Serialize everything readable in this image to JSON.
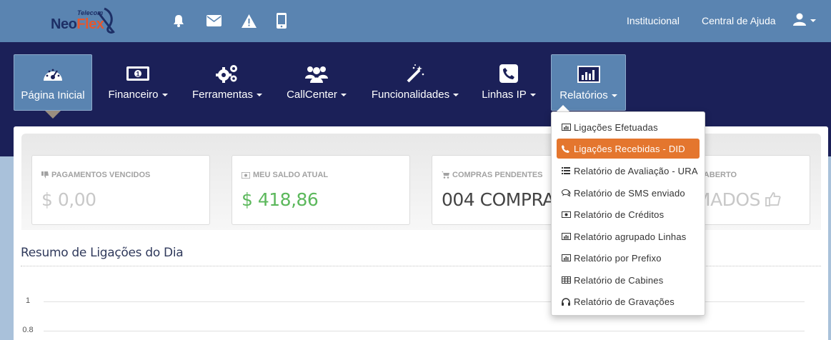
{
  "brand": {
    "logo_top": "Telecom",
    "logo_word_1": "Neo",
    "logo_word_2": "Flex"
  },
  "topbar": {
    "icons": [
      "bell-icon",
      "envelope-icon",
      "warning-icon",
      "mobile-icon"
    ],
    "links": [
      "Institucional",
      "Central de Ajuda"
    ],
    "user_icon": "user-icon"
  },
  "nav": {
    "items": [
      {
        "label": "Página Inicial",
        "icon": "dashboard-icon",
        "active": true,
        "has_caret": false
      },
      {
        "label": "Financeiro",
        "icon": "money-icon",
        "has_caret": true
      },
      {
        "label": "Ferramentas",
        "icon": "cogs-icon",
        "has_caret": true
      },
      {
        "label": "CallCenter",
        "icon": "users-icon",
        "has_caret": true
      },
      {
        "label": "Funcionalidades",
        "icon": "magic-wand-icon",
        "has_caret": true
      },
      {
        "label": "Linhas IP",
        "icon": "phone-icon",
        "has_caret": true
      },
      {
        "label": "Relatórios",
        "icon": "bar-chart-icon",
        "open": true,
        "has_caret": true
      }
    ]
  },
  "stats": [
    {
      "label": "PAGAMENTOS VENCIDOS",
      "value": "$ 0,00",
      "icon": "thumbs-down-icon",
      "color": "#c8c8c8"
    },
    {
      "label": "MEU SALDO ATUAL",
      "value": "$ 418,86",
      "icon": "money-icon",
      "color": "#5cb85c"
    },
    {
      "label": "COMPRAS PENDENTES",
      "value": "004 COMPRAS",
      "icon": "cart-icon",
      "color": "#444444"
    },
    {
      "label": "M ABERTO",
      "value": "MADOS",
      "icon": "thumbs-up-icon",
      "color": "#c8c8c8"
    }
  ],
  "section": {
    "title": "Resumo de Ligações do Dia"
  },
  "chart_data": {
    "type": "line",
    "y_ticks": [
      "1",
      "0.8"
    ]
  },
  "dropdown": {
    "items": [
      {
        "label": "Ligações Efetuadas",
        "icon": "bar-chart-icon"
      },
      {
        "label": "Ligações Recebidas - DID",
        "icon": "phone-icon",
        "active": true
      },
      {
        "label": "Relatório de Avaliação - URA",
        "icon": "list-icon"
      },
      {
        "label": "Relatório de SMS enviado",
        "icon": "comments-icon"
      },
      {
        "label": "Relatório de Créditos",
        "icon": "money-icon"
      },
      {
        "label": "Relatório agrupado Linhas",
        "icon": "bar-chart-icon"
      },
      {
        "label": "Relatório por Prefixo",
        "icon": "bar-chart-icon"
      },
      {
        "label": "Relatório de Cabines",
        "icon": "table-icon"
      },
      {
        "label": "Relatório de Gravações",
        "icon": "headphones-icon"
      }
    ]
  },
  "colors": {
    "topbar": "#5a84b1",
    "navbar": "#1b2058",
    "accent": "#e4762e",
    "positive": "#5cb85c"
  }
}
